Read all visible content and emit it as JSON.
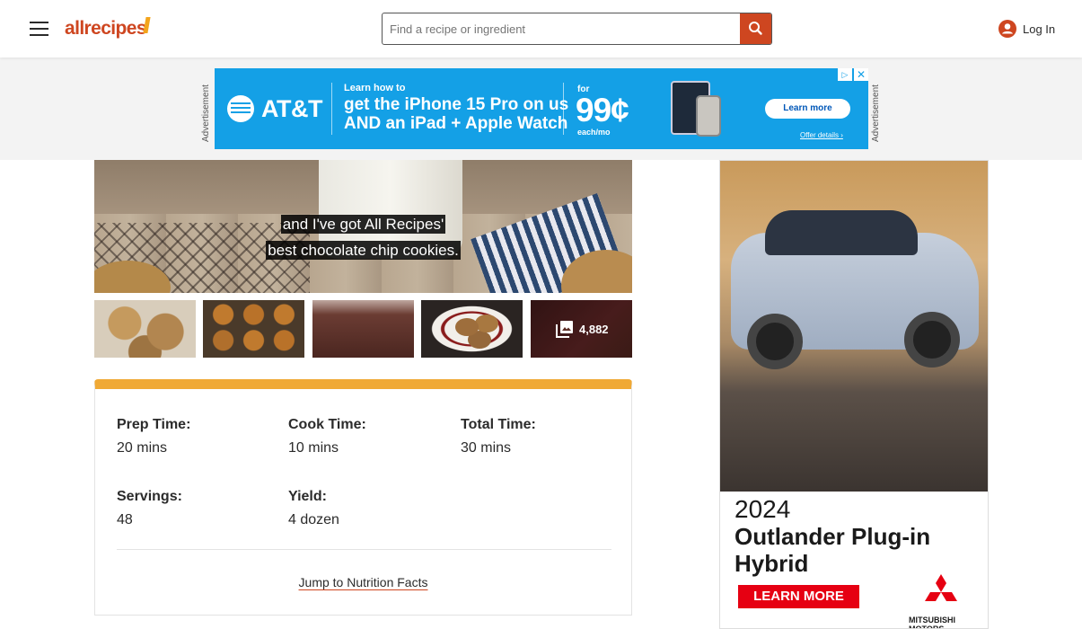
{
  "header": {
    "logo_text": "allrecipes",
    "search_placeholder": "Find a recipe or ingredient",
    "login_label": "Log In"
  },
  "ad_banner": {
    "label": "Advertisement",
    "brand": "AT&T",
    "small_text": "Learn how to",
    "headline_line1": "get the iPhone 15 Pro on us",
    "headline_line2": "AND an iPad + Apple Watch",
    "for_text": "for",
    "price": "99¢",
    "per_month": "each/mo",
    "cta": "Learn more",
    "offer_details": "Offer details ›",
    "adchoices": "▷",
    "close": "✕"
  },
  "video": {
    "caption_line1": "and I've got All Recipes'",
    "caption_line2": "best chocolate chip cookies."
  },
  "gallery": {
    "photo_count": "4,882"
  },
  "recipe_details": {
    "items": [
      {
        "label": "Prep Time:",
        "value": "20 mins"
      },
      {
        "label": "Cook Time:",
        "value": "10 mins"
      },
      {
        "label": "Total Time:",
        "value": "30 mins"
      },
      {
        "label": "Servings:",
        "value": "48"
      },
      {
        "label": "Yield:",
        "value": "4 dozen"
      }
    ],
    "nutrition_link": "Jump to Nutrition Facts"
  },
  "side_ad": {
    "year": "2024",
    "model_line1": "Outlander Plug-in",
    "model_line2": "Hybrid",
    "cta": "LEARN MORE",
    "brand": "MITSUBISHI MOTORS"
  },
  "colors": {
    "brand_orange": "#ce4620",
    "accent_yellow": "#f0a935",
    "att_blue": "#14a0e6",
    "mitsubishi_red": "#e60012"
  }
}
